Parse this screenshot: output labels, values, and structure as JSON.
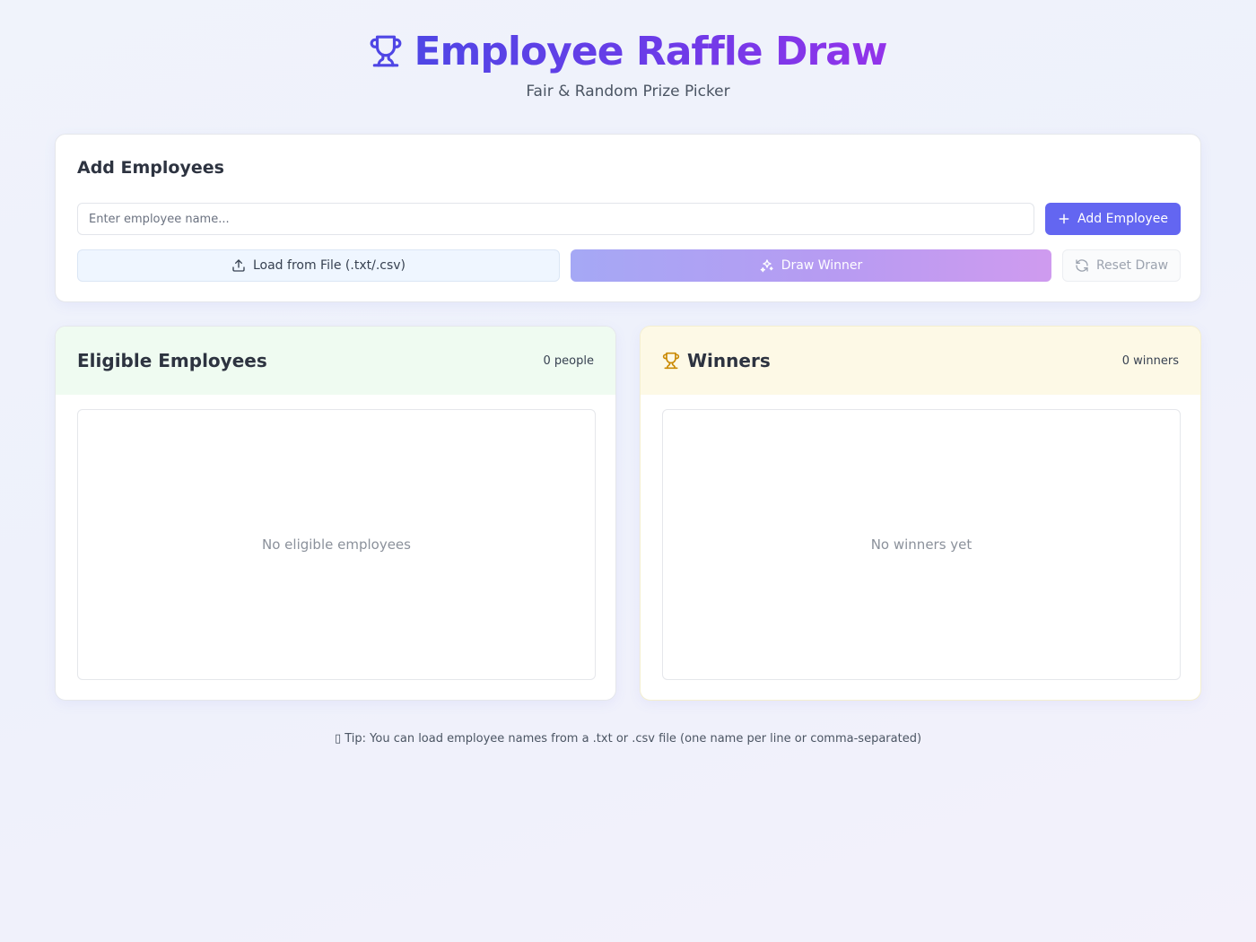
{
  "header": {
    "icon": "trophy-icon",
    "title": "Employee Raffle Draw",
    "subtitle": "Fair & Random Prize Picker"
  },
  "add_card": {
    "title": "Add Employees",
    "input_placeholder": "Enter employee name...",
    "input_value": "",
    "add_button": {
      "icon": "plus-icon",
      "label": "Add Employee"
    },
    "load_button": {
      "icon": "upload-icon",
      "label": "Load from File (.txt/.csv)"
    },
    "draw_button": {
      "icon": "sparkles-icon",
      "label": "Draw Winner"
    },
    "reset_button": {
      "icon": "refresh-icon",
      "label": "Reset Draw"
    }
  },
  "eligible_panel": {
    "title": "Eligible Employees",
    "count": "0 people",
    "empty_text": "No eligible employees",
    "items": []
  },
  "winners_panel": {
    "icon": "trophy-icon",
    "title": "Winners",
    "count": "0 winners",
    "empty_text": "No winners yet",
    "items": []
  },
  "tip": "▯ Tip: You can load employee names from a .txt or .csv file (one name per line or comma-separated)",
  "colors": {
    "accent": "#6366f1",
    "title_gradient_start": "#4f46e5",
    "title_gradient_end": "#9333ea",
    "winners_icon": "#ca8a04",
    "eligible_header_bg": "#effbf1",
    "winners_header_bg": "#fdf9e6"
  }
}
